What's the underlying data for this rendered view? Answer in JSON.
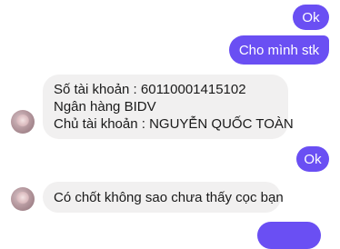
{
  "messages": [
    {
      "direction": "sent",
      "text": "Ok"
    },
    {
      "direction": "sent",
      "text": "Cho mình stk"
    },
    {
      "direction": "received",
      "lines": [
        "Số tài khoản : 60110001415102",
        "Ngân hàng BIDV",
        "Chủ tài khoản : NGUYỄN QUỐC TOÀN"
      ]
    },
    {
      "direction": "sent",
      "text": "Ok"
    },
    {
      "direction": "received",
      "text": "Có chốt không sao chưa thấy cọc bạn"
    }
  ],
  "colors": {
    "sent_bubble": "#6a4ff3",
    "received_bubble": "#f1f0f0",
    "background": "#ffffff"
  },
  "icons": {
    "avatar": "contact-avatar"
  }
}
